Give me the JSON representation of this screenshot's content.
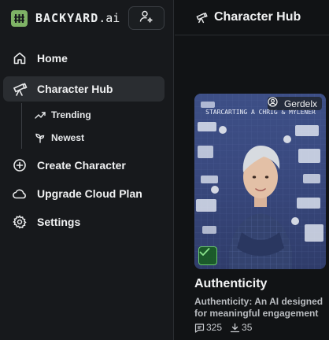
{
  "brand": {
    "name": "BACKYARD",
    "suffix": ".ai",
    "accent": "#7fb366"
  },
  "header": {
    "profile_icon": "user-settings-icon"
  },
  "sidebar": {
    "items": [
      {
        "label": "Home",
        "icon": "home-icon"
      },
      {
        "label": "Character Hub",
        "icon": "telescope-icon",
        "active": true
      },
      {
        "label": "Create Character",
        "icon": "plus-circle-icon"
      },
      {
        "label": "Upgrade Cloud Plan",
        "icon": "cloud-icon"
      },
      {
        "label": "Settings",
        "icon": "gear-icon"
      }
    ],
    "sub_items": [
      {
        "label": "Trending",
        "icon": "trending-icon"
      },
      {
        "label": "Newest",
        "icon": "sprout-icon"
      }
    ]
  },
  "main": {
    "title": "Character Hub",
    "card": {
      "creator": "Gerdelx",
      "title": "Authenticity",
      "description": "Authenticity: An AI designed for meaningful engagement",
      "messages": "325",
      "downloads": "35",
      "poster_text": "STARCARTING A CHRIG & MYLENER"
    }
  }
}
